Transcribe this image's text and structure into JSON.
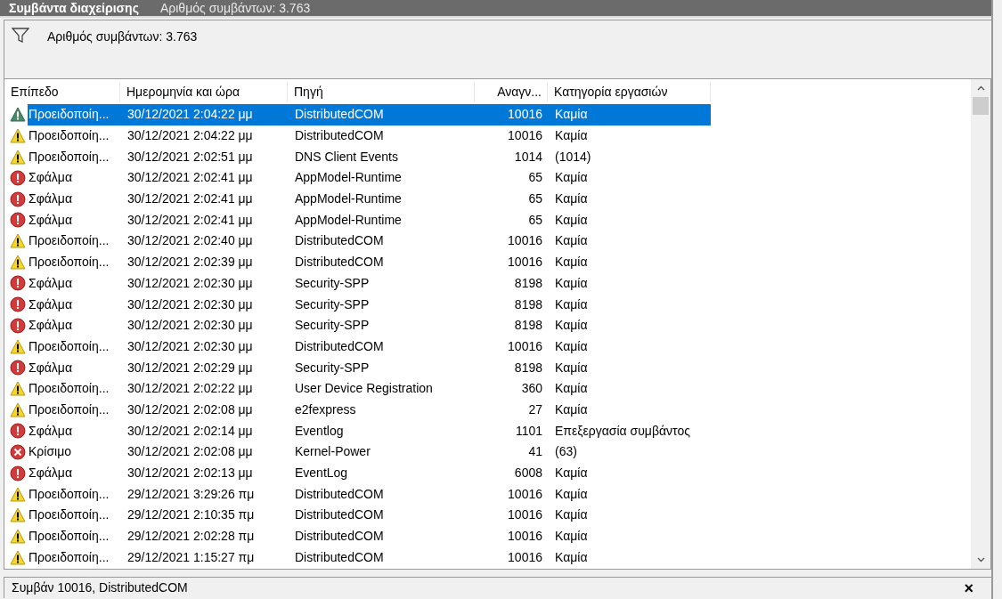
{
  "header": {
    "title": "Συμβάντα διαχείρισης",
    "subtitle": "Αριθμός συμβάντων: 3.763"
  },
  "filter": {
    "text": "Αριθμός συμβάντων: 3.763"
  },
  "table": {
    "columns": [
      "Επίπεδο",
      "Ημερομηνία και ώρα",
      "Πηγή",
      "Αναγν...",
      "Κατηγορία εργασιών"
    ],
    "rows": [
      {
        "kind": "warning",
        "selected": true,
        "level": "Προειδοποίη...",
        "date": "30/12/2021 2:04:22 μμ",
        "source": "DistributedCOM",
        "id": "10016",
        "category": "Καμία"
      },
      {
        "kind": "warning",
        "selected": false,
        "level": "Προειδοποίη...",
        "date": "30/12/2021 2:04:22 μμ",
        "source": "DistributedCOM",
        "id": "10016",
        "category": "Καμία"
      },
      {
        "kind": "warning",
        "selected": false,
        "level": "Προειδοποίη...",
        "date": "30/12/2021 2:02:51 μμ",
        "source": "DNS Client Events",
        "id": "1014",
        "category": "(1014)"
      },
      {
        "kind": "error",
        "selected": false,
        "level": "Σφάλμα",
        "date": "30/12/2021 2:02:41 μμ",
        "source": "AppModel-Runtime",
        "id": "65",
        "category": "Καμία"
      },
      {
        "kind": "error",
        "selected": false,
        "level": "Σφάλμα",
        "date": "30/12/2021 2:02:41 μμ",
        "source": "AppModel-Runtime",
        "id": "65",
        "category": "Καμία"
      },
      {
        "kind": "error",
        "selected": false,
        "level": "Σφάλμα",
        "date": "30/12/2021 2:02:41 μμ",
        "source": "AppModel-Runtime",
        "id": "65",
        "category": "Καμία"
      },
      {
        "kind": "warning",
        "selected": false,
        "level": "Προειδοποίη...",
        "date": "30/12/2021 2:02:40 μμ",
        "source": "DistributedCOM",
        "id": "10016",
        "category": "Καμία"
      },
      {
        "kind": "warning",
        "selected": false,
        "level": "Προειδοποίη...",
        "date": "30/12/2021 2:02:39 μμ",
        "source": "DistributedCOM",
        "id": "10016",
        "category": "Καμία"
      },
      {
        "kind": "error",
        "selected": false,
        "level": "Σφάλμα",
        "date": "30/12/2021 2:02:30 μμ",
        "source": "Security-SPP",
        "id": "8198",
        "category": "Καμία"
      },
      {
        "kind": "error",
        "selected": false,
        "level": "Σφάλμα",
        "date": "30/12/2021 2:02:30 μμ",
        "source": "Security-SPP",
        "id": "8198",
        "category": "Καμία"
      },
      {
        "kind": "error",
        "selected": false,
        "level": "Σφάλμα",
        "date": "30/12/2021 2:02:30 μμ",
        "source": "Security-SPP",
        "id": "8198",
        "category": "Καμία"
      },
      {
        "kind": "warning",
        "selected": false,
        "level": "Προειδοποίη...",
        "date": "30/12/2021 2:02:30 μμ",
        "source": "DistributedCOM",
        "id": "10016",
        "category": "Καμία"
      },
      {
        "kind": "error",
        "selected": false,
        "level": "Σφάλμα",
        "date": "30/12/2021 2:02:29 μμ",
        "source": "Security-SPP",
        "id": "8198",
        "category": "Καμία"
      },
      {
        "kind": "warning",
        "selected": false,
        "level": "Προειδοποίη...",
        "date": "30/12/2021 2:02:22 μμ",
        "source": "User Device Registration",
        "id": "360",
        "category": "Καμία"
      },
      {
        "kind": "warning",
        "selected": false,
        "level": "Προειδοποίη...",
        "date": "30/12/2021 2:02:08 μμ",
        "source": "e2fexpress",
        "id": "27",
        "category": "Καμία"
      },
      {
        "kind": "error",
        "selected": false,
        "level": "Σφάλμα",
        "date": "30/12/2021 2:02:14 μμ",
        "source": "Eventlog",
        "id": "1101",
        "category": "Επεξεργασία συμβάντος"
      },
      {
        "kind": "critical",
        "selected": false,
        "level": "Κρίσιμο",
        "date": "30/12/2021 2:02:08 μμ",
        "source": "Kernel-Power",
        "id": "41",
        "category": "(63)"
      },
      {
        "kind": "error",
        "selected": false,
        "level": "Σφάλμα",
        "date": "30/12/2021 2:02:13 μμ",
        "source": "EventLog",
        "id": "6008",
        "category": "Καμία"
      },
      {
        "kind": "warning",
        "selected": false,
        "level": "Προειδοποίη...",
        "date": "29/12/2021 3:29:26 πμ",
        "source": "DistributedCOM",
        "id": "10016",
        "category": "Καμία"
      },
      {
        "kind": "warning",
        "selected": false,
        "level": "Προειδοποίη...",
        "date": "29/12/2021 2:10:35 πμ",
        "source": "DistributedCOM",
        "id": "10016",
        "category": "Καμία"
      },
      {
        "kind": "warning",
        "selected": false,
        "level": "Προειδοποίη...",
        "date": "29/12/2021 2:02:28 πμ",
        "source": "DistributedCOM",
        "id": "10016",
        "category": "Καμία"
      },
      {
        "kind": "warning",
        "selected": false,
        "level": "Προειδοποίη...",
        "date": "29/12/2021 1:15:27 πμ",
        "source": "DistributedCOM",
        "id": "10016",
        "category": "Καμία"
      }
    ]
  },
  "details": {
    "title": "Συμβάν 10016, DistributedCOM",
    "close": "×"
  }
}
